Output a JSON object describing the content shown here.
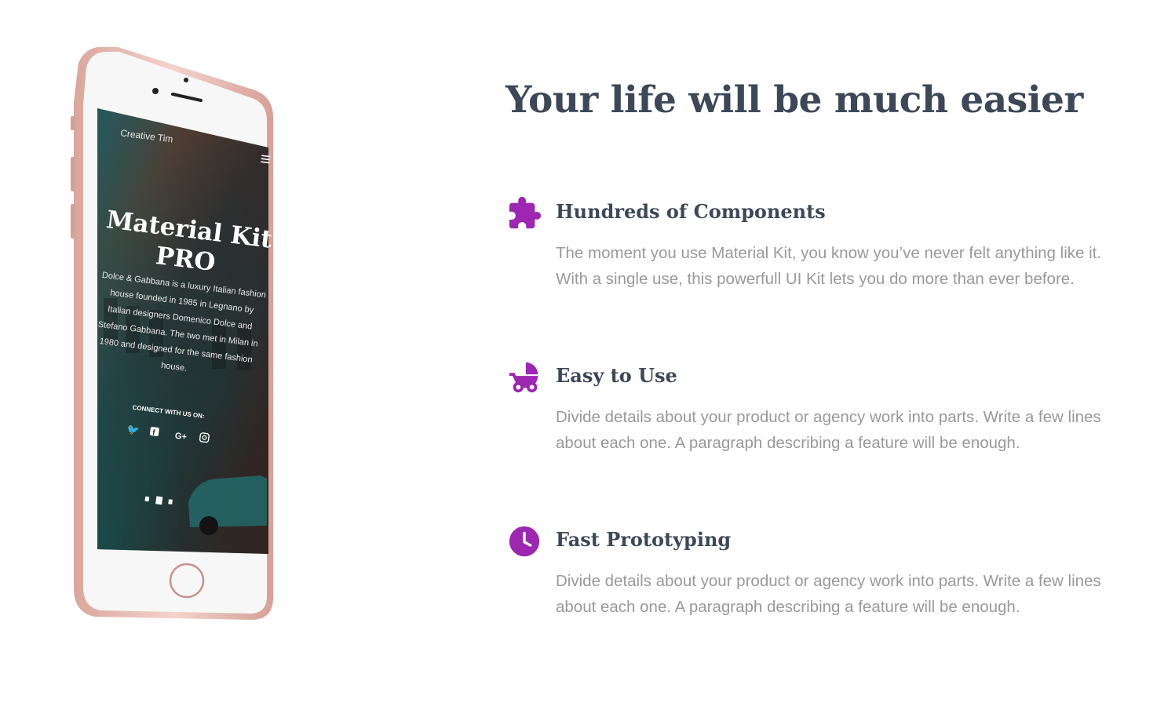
{
  "phone_screen": {
    "brand": "Creative Tim",
    "title_line1": "Material Kit",
    "title_line2": "PRO",
    "description_lines": [
      "Dolce & Gabbana is a luxury Italian fashion",
      "house founded in 1985 in Legnano by",
      "Italian designers Domenico Dolce and",
      "Stefano Gabbana. The two met in Milan in",
      "1980 and designed for the same fashion",
      "house."
    ],
    "connect_label": "CONNECT WITH US ON:",
    "social_icons": [
      "twitter-icon",
      "facebook-icon",
      "google-plus-icon",
      "instagram-icon"
    ],
    "carousel_slides": 3,
    "carousel_active_index": 1
  },
  "section": {
    "title": "Your life will be much easier"
  },
  "features": [
    {
      "icon": "puzzle-icon",
      "title": "Hundreds of Components",
      "description": "The moment you use Material Kit, you know you’ve never felt anything like it. With a single use, this powerfull UI Kit lets you do more than ever before."
    },
    {
      "icon": "stroller-icon",
      "title": "Easy to Use",
      "description": "Divide details about your product or agency work into parts. Write a few lines about each one. A paragraph describing a feature will be enough."
    },
    {
      "icon": "clock-icon",
      "title": "Fast Prototyping",
      "description": "Divide details about your product or agency work into parts. Write a few lines about each one. A paragraph describing a feature will be enough."
    }
  ],
  "colors": {
    "accent": "#9c27b0",
    "heading": "#3c4858",
    "body_text": "#999999",
    "phone_frame": "#e8b9b1"
  }
}
